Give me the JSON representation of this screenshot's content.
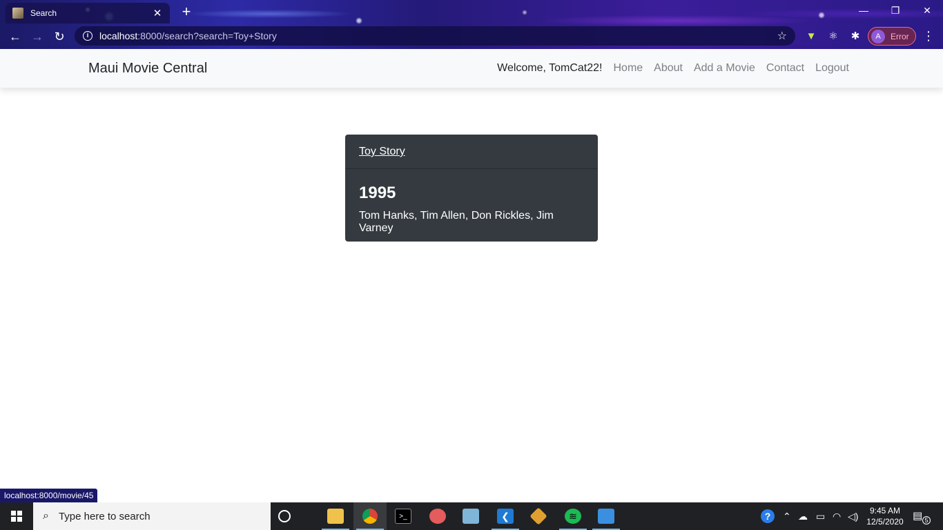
{
  "browser": {
    "tab": {
      "title": "Search"
    },
    "new_tab_glyph": "+",
    "window_controls": {
      "minimize": "—",
      "restore": "❐",
      "close": "✕"
    },
    "address": {
      "host": "localhost",
      "rest": ":8000/search?search=Toy+Story"
    },
    "profile": {
      "initial": "A",
      "status": "Error"
    }
  },
  "navbar": {
    "brand": "Maui Movie Central",
    "welcome": "Welcome, TomCat22!",
    "links": [
      "Home",
      "About",
      "Add a Movie",
      "Contact",
      "Logout"
    ]
  },
  "result": {
    "title": "Toy Story",
    "year": "1995",
    "cast": "Tom Hanks, Tim Allen, Don Rickles, Jim Varney"
  },
  "status_bar": {
    "hover_url": "localhost:8000/movie/45"
  },
  "taskbar": {
    "search_placeholder": "Type here to search",
    "time": "9:45 AM",
    "date": "12/5/2020",
    "notification_count": "5",
    "apps": [
      "file-explorer",
      "chrome",
      "terminal",
      "paint",
      "notepad",
      "vscode",
      "git",
      "spotify",
      "photos"
    ]
  },
  "colors": {
    "card_bg": "#343a40",
    "navbar_bg": "#f8f9fa",
    "accent": "#76b9ed"
  }
}
